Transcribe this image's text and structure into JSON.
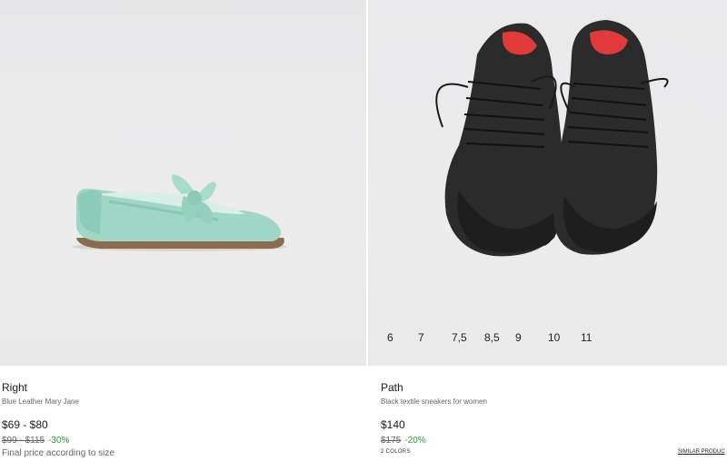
{
  "products": [
    {
      "name": "Right",
      "description": "Blue Leather Mary Jane",
      "price": "$69 - $80",
      "original_price": "$99 - $115",
      "discount": "-30%",
      "note": "Final price according to size"
    },
    {
      "name": "Path",
      "description": "Black textile sneakers for women",
      "price": "$140",
      "original_price": "$175",
      "discount": "-20%",
      "colors_label": "2 COLORS",
      "similar_label": "SIMILAR PRODUC",
      "sizes": [
        "6",
        "7",
        "7,5",
        "8,5",
        "9",
        "10",
        "11"
      ]
    }
  ],
  "colors": {
    "discount": "#2e9b3a",
    "mary_jane": "#9fd6c6",
    "sneaker": "#2b2b2b",
    "insole": "#e23a3a"
  }
}
